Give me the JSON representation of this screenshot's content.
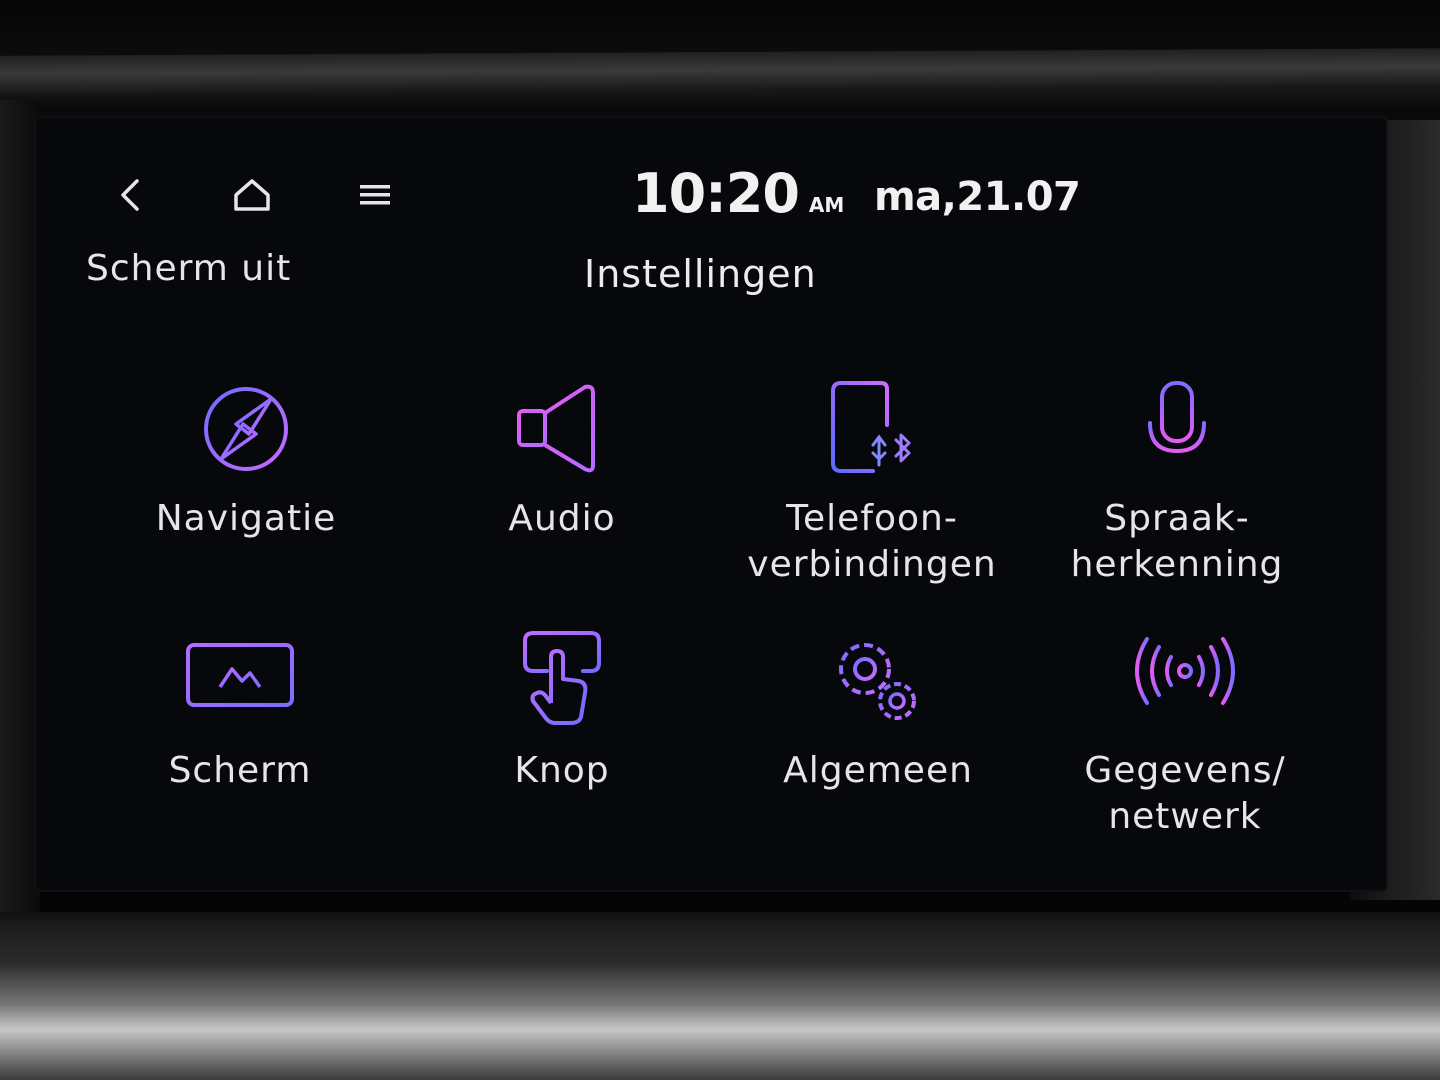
{
  "topbar": {
    "back_icon": "chevron-left-icon",
    "home_icon": "home-icon",
    "menu_icon": "hamburger-menu-icon",
    "time": "10:20",
    "ampm": "AM",
    "date": "ma,21.07"
  },
  "header": {
    "screen_off_label": "Scherm uit",
    "title": "Instellingen"
  },
  "tiles": [
    {
      "label": "Navigatie",
      "icon": "compass-icon"
    },
    {
      "label": "Audio",
      "icon": "speaker-icon"
    },
    {
      "label": "Telefoon-\nverbindingen",
      "icon": "phone-connection-icon"
    },
    {
      "label": "Spraak-\nherkenning",
      "icon": "microphone-icon"
    },
    {
      "label": "Scherm",
      "icon": "display-icon"
    },
    {
      "label": "Knop",
      "icon": "touch-button-icon"
    },
    {
      "label": "Algemeen",
      "icon": "gears-icon"
    },
    {
      "label": "Gegevens/\nnetwerk",
      "icon": "antenna-icon"
    }
  ],
  "colors": {
    "icon_blue": "#6f6cff",
    "icon_purple": "#b56bff",
    "icon_pink": "#e35cf0",
    "text": "#e6e6e6"
  }
}
